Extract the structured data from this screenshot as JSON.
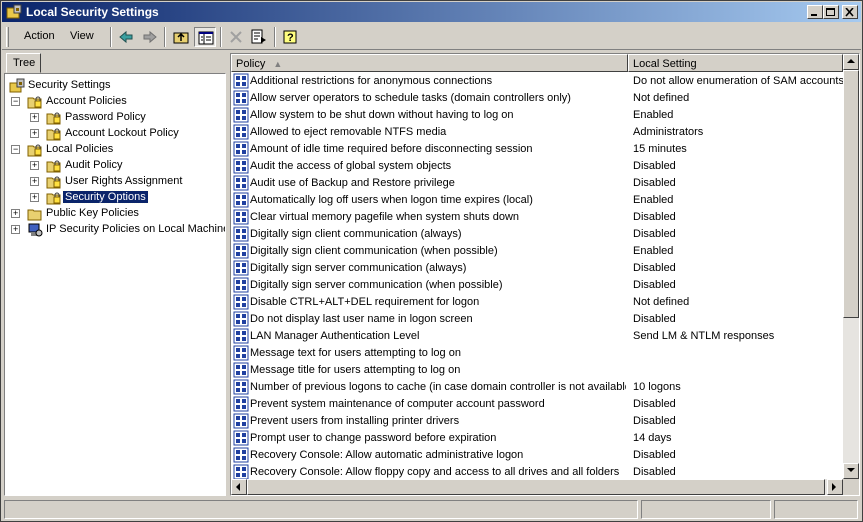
{
  "window": {
    "title": "Local Security Settings",
    "title_gradient": [
      "#0a246a",
      "#a6caf0"
    ]
  },
  "menu": {
    "action": "Action",
    "view": "View"
  },
  "icons": {
    "app": "security-settings-icon",
    "back": "back-arrow-icon",
    "forward": "forward-arrow-icon",
    "up": "up-folder-icon",
    "show_tree": "show-hide-tree-icon",
    "delete": "delete-x-icon",
    "export": "export-list-icon",
    "help": "help-icon",
    "policy": "policy-item-icon"
  },
  "tree": {
    "tab_label": "Tree",
    "items": [
      {
        "label": "Security Settings",
        "level": 0,
        "expander": "",
        "icon": "security-settings-icon"
      },
      {
        "label": "Account Policies",
        "level": 1,
        "expander": "−",
        "icon": "folder-lock-icon"
      },
      {
        "label": "Password Policy",
        "level": 2,
        "expander": "+",
        "icon": "folder-lock-icon"
      },
      {
        "label": "Account Lockout Policy",
        "level": 2,
        "expander": "+",
        "icon": "folder-lock-icon"
      },
      {
        "label": "Local Policies",
        "level": 1,
        "expander": "−",
        "icon": "folder-lock-icon"
      },
      {
        "label": "Audit Policy",
        "level": 2,
        "expander": "+",
        "icon": "folder-lock-icon"
      },
      {
        "label": "User Rights Assignment",
        "level": 2,
        "expander": "+",
        "icon": "folder-lock-icon"
      },
      {
        "label": "Security Options",
        "level": 2,
        "expander": "+",
        "icon": "folder-lock-icon",
        "selected": true
      },
      {
        "label": "Public Key Policies",
        "level": 1,
        "expander": "+",
        "icon": "folder-icon"
      },
      {
        "label": "IP Security Policies on Local Machine",
        "level": 1,
        "expander": "+",
        "icon": "ip-security-icon"
      }
    ]
  },
  "list": {
    "columns": {
      "policy": "Policy",
      "setting": "Local Setting"
    },
    "rows": [
      {
        "policy": "Additional restrictions for anonymous connections",
        "setting": "Do not allow enumeration of SAM accounts"
      },
      {
        "policy": "Allow server operators to schedule tasks (domain controllers only)",
        "setting": "Not defined"
      },
      {
        "policy": "Allow system to be shut down without having to log on",
        "setting": "Enabled"
      },
      {
        "policy": "Allowed to eject removable NTFS media",
        "setting": "Administrators"
      },
      {
        "policy": "Amount of idle time required before disconnecting session",
        "setting": "15 minutes"
      },
      {
        "policy": "Audit the access of global system objects",
        "setting": "Disabled"
      },
      {
        "policy": "Audit use of Backup and Restore privilege",
        "setting": "Disabled"
      },
      {
        "policy": "Automatically log off users when logon time expires (local)",
        "setting": "Enabled"
      },
      {
        "policy": "Clear virtual memory pagefile when system shuts down",
        "setting": "Disabled"
      },
      {
        "policy": "Digitally sign client communication (always)",
        "setting": "Disabled"
      },
      {
        "policy": "Digitally sign client communication (when possible)",
        "setting": "Enabled"
      },
      {
        "policy": "Digitally sign server communication (always)",
        "setting": "Disabled"
      },
      {
        "policy": "Digitally sign server communication (when possible)",
        "setting": "Disabled"
      },
      {
        "policy": "Disable CTRL+ALT+DEL requirement for logon",
        "setting": "Not defined"
      },
      {
        "policy": "Do not display last user name in logon screen",
        "setting": "Disabled"
      },
      {
        "policy": "LAN Manager Authentication Level",
        "setting": "Send LM & NTLM responses"
      },
      {
        "policy": "Message text for users attempting to log on",
        "setting": ""
      },
      {
        "policy": "Message title for users attempting to log on",
        "setting": ""
      },
      {
        "policy": "Number of previous logons to cache (in case domain controller is not available)",
        "setting": "10 logons"
      },
      {
        "policy": "Prevent system maintenance of computer account password",
        "setting": "Disabled"
      },
      {
        "policy": "Prevent users from installing printer drivers",
        "setting": "Disabled"
      },
      {
        "policy": "Prompt user to change password before expiration",
        "setting": "14 days"
      },
      {
        "policy": "Recovery Console: Allow automatic administrative logon",
        "setting": "Disabled"
      },
      {
        "policy": "Recovery Console: Allow floppy copy and access to all drives and all folders",
        "setting": "Disabled"
      }
    ]
  }
}
